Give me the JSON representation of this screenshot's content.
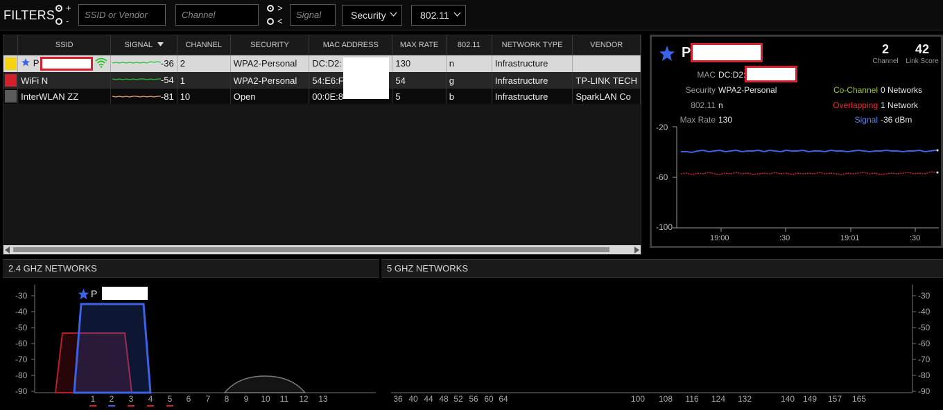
{
  "filters": {
    "title": "FILTERS",
    "plus": "+",
    "minus": "-",
    "gt": ">",
    "lt": "<",
    "ssid_placeholder": "SSID or Vendor",
    "channel_placeholder": "Channel",
    "signal_placeholder": "Signal",
    "security_label": "Security",
    "mode_label": "802.11"
  },
  "table": {
    "columns": [
      "SSID",
      "SIGNAL",
      "CHANNEL",
      "SECURITY",
      "MAC ADDRESS",
      "MAX RATE",
      "802.11",
      "NETWORK TYPE",
      "VENDOR"
    ],
    "sort_column": "SIGNAL",
    "rows": [
      {
        "color": "#f5d40f",
        "ssid": "P",
        "signal": "-36",
        "channel": "2",
        "security": "WPA2-Personal",
        "mac": "DC:D2:",
        "max_rate": "130",
        "mode": "n",
        "type": "Infrastructure",
        "vendor": "",
        "favorite": true
      },
      {
        "color": "#d3202d",
        "ssid": "WiFi N",
        "signal": "-54",
        "channel": "1",
        "security": "WPA2-Personal",
        "mac": "54:E6:F",
        "max_rate": "54",
        "mode": "g",
        "type": "Infrastructure",
        "vendor": "TP-LINK TECH"
      },
      {
        "color": "#5a5a5a",
        "ssid": "InterWLAN ZZ",
        "signal": "-81",
        "channel": "10",
        "security": "Open",
        "mac": "00:0E:8",
        "max_rate": "5",
        "mode": "b",
        "type": "Infrastructure",
        "vendor": "SparkLAN Co"
      }
    ]
  },
  "detail": {
    "ssid": "P",
    "channel": "2",
    "channel_label": "Channel",
    "link_score": "42",
    "link_score_label": "Link Score",
    "mac_label": "MAC",
    "mac": "DC:D2:",
    "security_label": "Security",
    "security": "WPA2-Personal",
    "mode_label": "802.11",
    "mode": "n",
    "maxrate_label": "Max Rate",
    "maxrate": "130",
    "cochannel_label": "Co-Channel",
    "cochannel": "0 Networks",
    "overlapping_label": "Overlapping",
    "overlapping": "1 Network",
    "signal_label": "Signal",
    "signal": "-36 dBm",
    "y_ticks": [
      "-20",
      "-60",
      "-100"
    ],
    "x_ticks": [
      "19:00",
      ":30",
      "19:01",
      ":30"
    ]
  },
  "band24": {
    "title": "2.4 GHZ NETWORKS",
    "y_ticks": [
      "-30",
      "-40",
      "-50",
      "-60",
      "-70",
      "-80",
      "-90"
    ],
    "channels": [
      "1",
      "2",
      "3",
      "4",
      "5",
      "6",
      "7",
      "8",
      "9",
      "10",
      "11",
      "12",
      "13"
    ],
    "network_label": "P"
  },
  "band5": {
    "title": "5 GHZ NETWORKS",
    "y_ticks": [
      "-30",
      "-40",
      "-50",
      "-60",
      "-70",
      "-80",
      "-90"
    ],
    "channels": [
      "36",
      "40",
      "44",
      "48",
      "52",
      "56",
      "60",
      "64",
      "100",
      "108",
      "116",
      "124",
      "132",
      "140",
      "149",
      "157",
      "165"
    ]
  },
  "colors": {
    "selected_blue": "#3b63e6",
    "red_series": "#d3202d",
    "gray_series": "#777777",
    "signal_green": "#26c32b",
    "cochannel_green": "#9acd32",
    "overlap_red": "#e0332f",
    "signal_blue": "#5b82f0"
  }
}
